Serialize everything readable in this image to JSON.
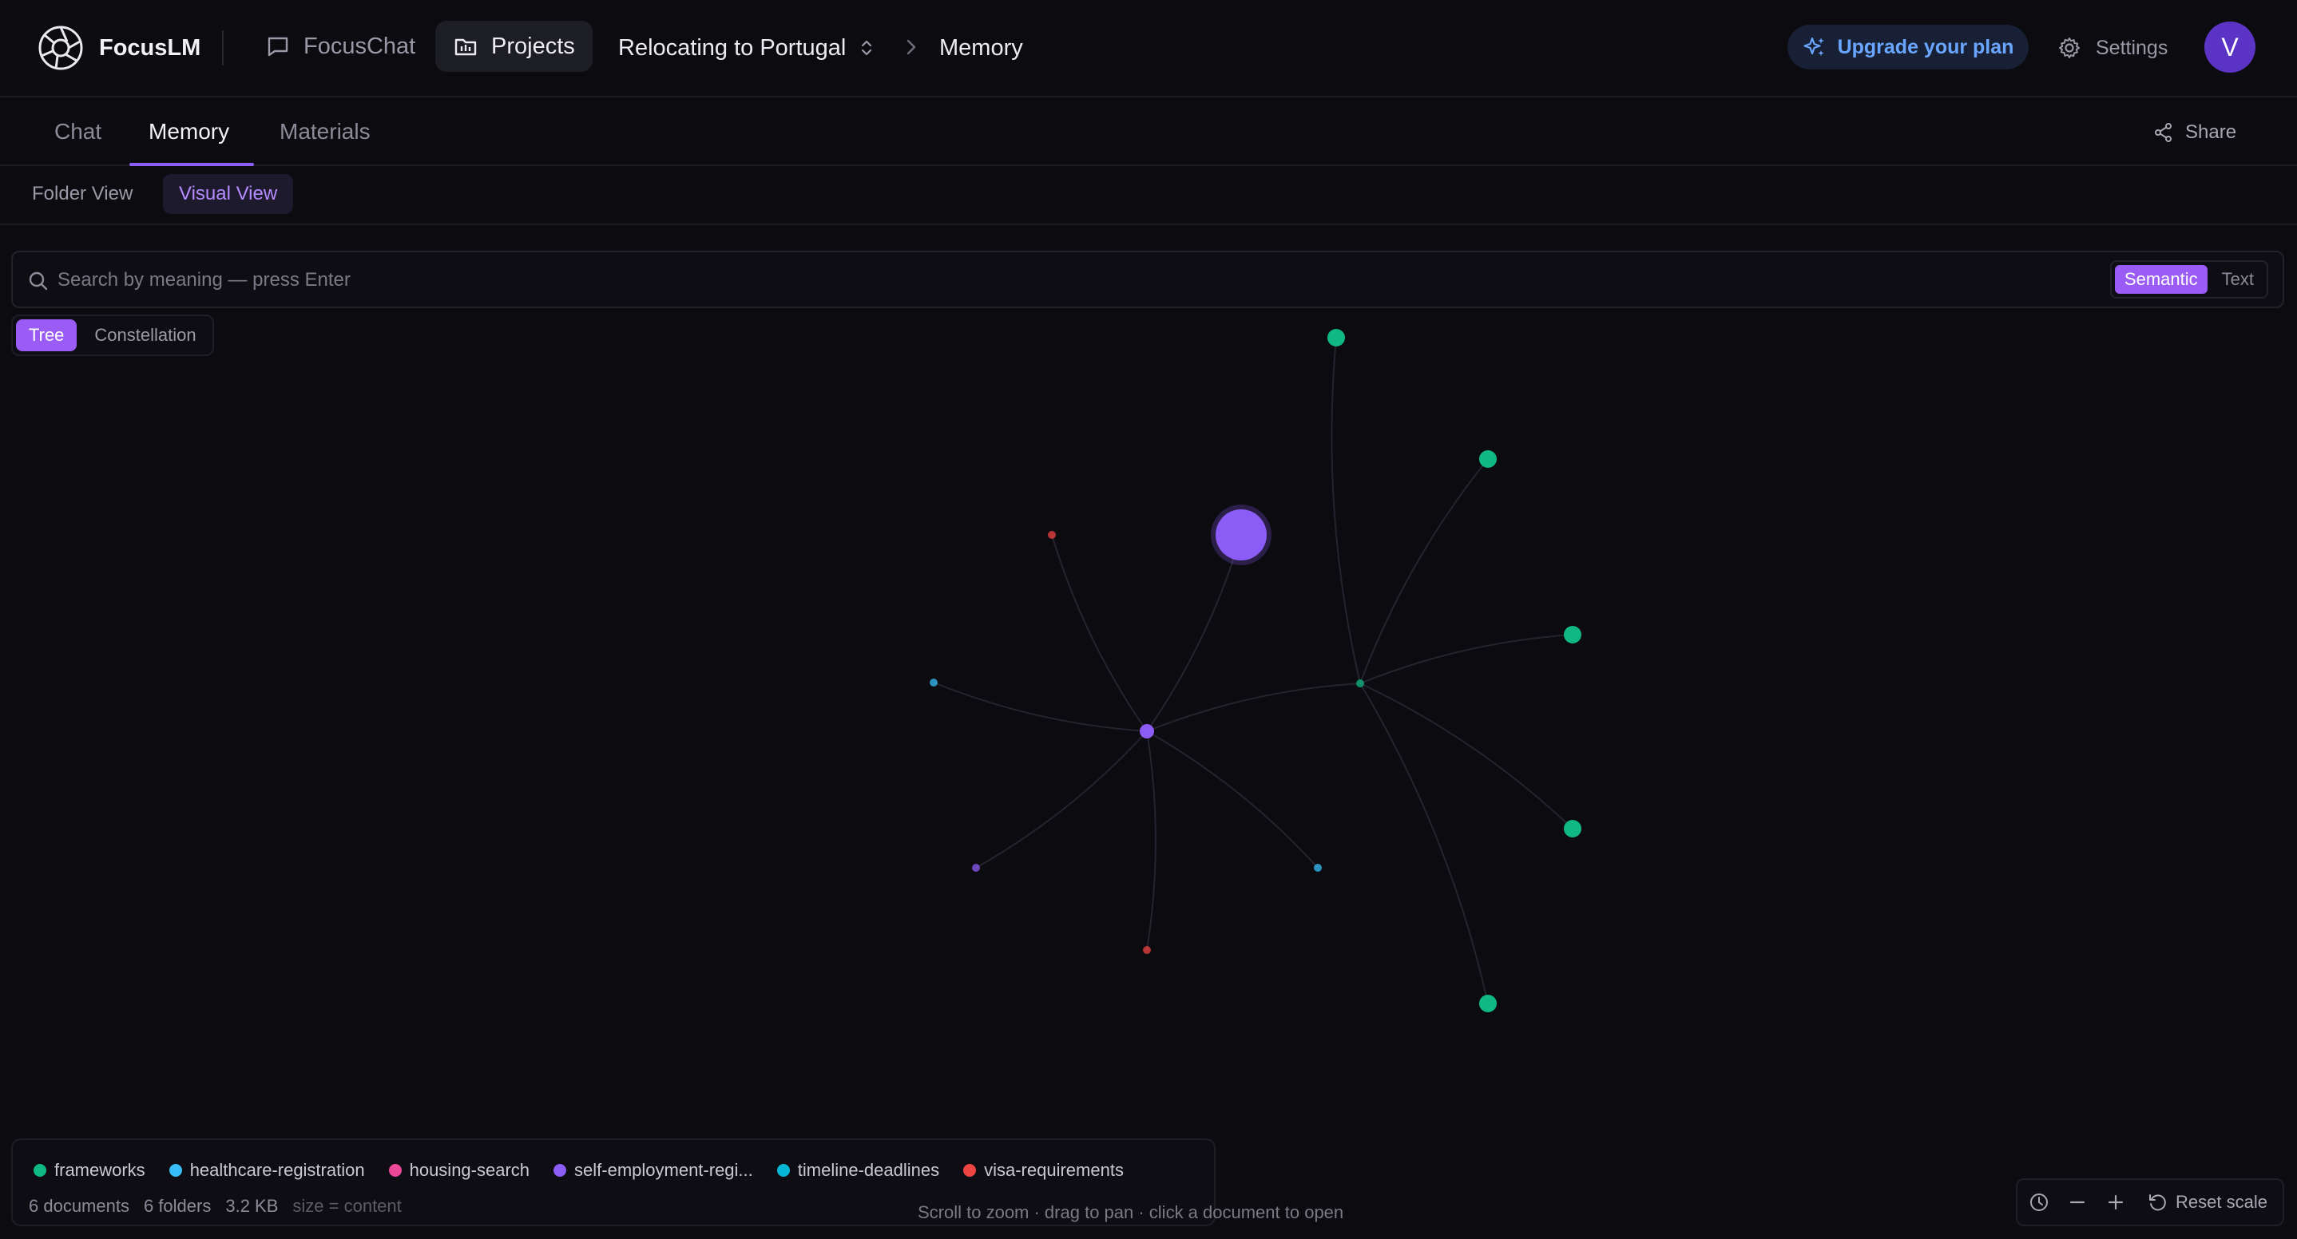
{
  "app": {
    "name": "FocusLM"
  },
  "nav": {
    "focuschat_label": "FocusChat",
    "projects_label": "Projects"
  },
  "breadcrumb": {
    "project": "Relocating to Portugal",
    "page": "Memory"
  },
  "header": {
    "upgrade_label": "Upgrade your plan",
    "settings_label": "Settings",
    "avatar_initial": "V"
  },
  "tabs": [
    {
      "label": "Chat",
      "active": false
    },
    {
      "label": "Memory",
      "active": true
    },
    {
      "label": "Materials",
      "active": false
    }
  ],
  "share_label": "Share",
  "views": {
    "folder_label": "Folder View",
    "visual_label": "Visual View",
    "active": "Visual View"
  },
  "search": {
    "placeholder": "Search by meaning — press Enter",
    "value": "",
    "modes": [
      "Semantic",
      "Text"
    ],
    "active_mode": "Semantic"
  },
  "graph_layout": {
    "options": [
      "Tree",
      "Constellation"
    ],
    "active": "Tree"
  },
  "legend": {
    "categories": [
      {
        "label": "frameworks",
        "color": "#10b981"
      },
      {
        "label": "healthcare-registration",
        "color": "#38bdf8"
      },
      {
        "label": "housing-search",
        "color": "#ec4899"
      },
      {
        "label": "self-employment-regi...",
        "color": "#8b5cf6"
      },
      {
        "label": "timeline-deadlines",
        "color": "#06b6d4"
      },
      {
        "label": "visa-requirements",
        "color": "#ef4444"
      }
    ],
    "stats": {
      "documents": "6 documents",
      "folders": "6 folders",
      "size": "3.2 KB",
      "size_note": "size = content"
    }
  },
  "hint": "Scroll to zoom · drag to pan · click a document to open",
  "zoom": {
    "reset_label": "Reset scale"
  },
  "colors": {
    "accent": "#8b5cf6",
    "root_node": "#8b5cf6",
    "frameworks": "#10b981",
    "healthcare": "#38bdf8",
    "housing": "#ec4899",
    "self_employment": "#8b5cf6",
    "timeline": "#06b6d4",
    "visa": "#ef4444"
  }
}
